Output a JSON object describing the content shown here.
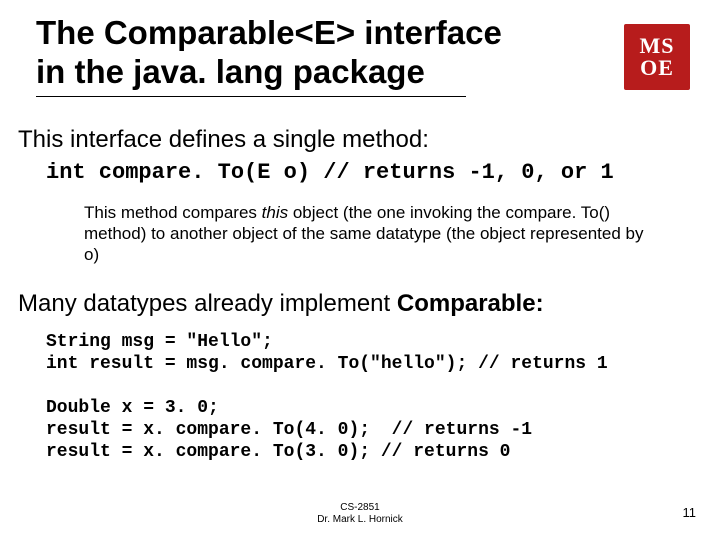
{
  "title": {
    "line1": "The Comparable<E> interface",
    "line2": "in the java. lang package"
  },
  "logo": {
    "line1": "MS",
    "line2": "OE"
  },
  "intro": "This interface defines a single method:",
  "method_signature": "int compare. To(E o) // returns -1, 0, or 1",
  "method_desc_1": "This method compares ",
  "method_desc_this": "this",
  "method_desc_2": " object (the one invoking the compare. To() method) to another object of the same datatype (the object represented by o)",
  "implements_line_pre": "Many datatypes already implement ",
  "implements_line_bold": "Comparable:",
  "code_block": "String msg = \"Hello\";\nint result = msg. compare. To(\"hello\"); // returns 1\n\nDouble x = 3. 0;\nresult = x. compare. To(4. 0);  // returns -1\nresult = x. compare. To(3. 0); // returns 0",
  "footer": {
    "course": "CS-2851",
    "author": "Dr. Mark L. Hornick"
  },
  "page_number": "11"
}
